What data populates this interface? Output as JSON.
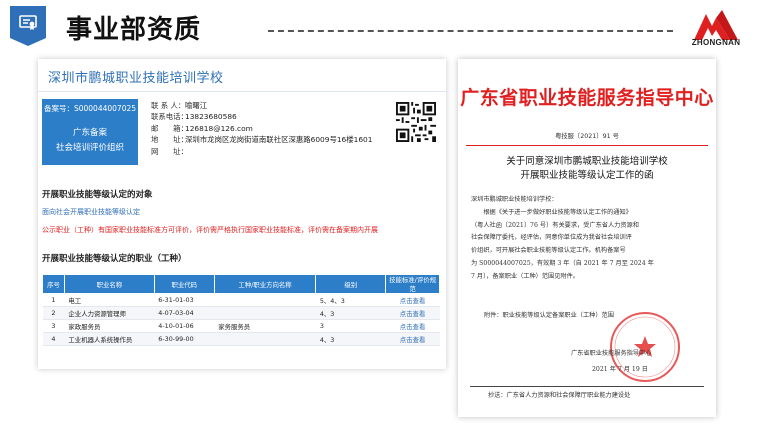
{
  "header": {
    "title": "事业部资质",
    "logo_text": "ZHONGNAN",
    "accent_color": "#2f6fb7"
  },
  "card": {
    "school_name": "深圳市鹏城职业技能培训学校",
    "badge": {
      "record_no": "备案号：S000044007025",
      "line1": "广东备案",
      "line2": "社会培训评价组织"
    },
    "contact": [
      {
        "label": "联 系 人：",
        "value": "喻曙江"
      },
      {
        "label": "联系电话：",
        "value": "13823680586"
      },
      {
        "label": "邮　　箱：",
        "value": "126818@126.com"
      },
      {
        "label": "地　　址：",
        "value": "深圳市龙岗区龙岗街道南联社区深惠路6009号16楼1601"
      },
      {
        "label": "网　　址：",
        "value": ""
      }
    ],
    "section1_title": "开展职业技能等级认定的对象",
    "section1_line1": "面向社会开展职业技能等级认定",
    "section1_line2": "公示职业（工种）有国家职业技能标准方可评价，评价需严格执行国家职业技能标准，评价需在备案期内开展",
    "section2_title": "开展职业技能等级认定的职业（工种）",
    "table": {
      "headers": [
        "序号",
        "职业名称",
        "职业代码",
        "工种/职业方向名称",
        "级别",
        "技能标准/评价规范"
      ],
      "rows": [
        [
          "1",
          "电工",
          "6-31-01-03",
          "",
          "5、4、3",
          "点击查看"
        ],
        [
          "2",
          "企业人力资源管理师",
          "4-07-03-04",
          "",
          "4、3",
          "点击查看"
        ],
        [
          "3",
          "家政服务员",
          "4-10-01-06",
          "家务服务员",
          "3",
          "点击查看"
        ],
        [
          "4",
          "工业机器人系统操作员",
          "6-30-99-00",
          "",
          "4、3",
          "点击查看"
        ]
      ]
    }
  },
  "doc": {
    "heading": "广东省职业技能服务指导中心",
    "number": "粤技服〔2021〕91 号",
    "title1": "关于同意深圳市鹏城职业技能培训学校",
    "title2": "开展职业技能等级认定工作的函",
    "body": [
      "深圳市鹏城职业技能培训学校：",
      "　　根据《关于进一步做好职业技能等级认定工作的通知》",
      "（粤人社函〔2021〕76 号）有关要求，受广东省人力资源和",
      "社会保障厅委托，经评估，同意你单位成为我省社会培训评",
      "价组织，可开展社会职业技能等级认定工作。机构备案号",
      "为 S000044007025，有效期 3 年（自 2021 年 7 月至 2024 年",
      "7 月），备案职业（工种）范围见附件。"
    ],
    "attachment": "附件：职业技能等级认定备案职业（工种）范围",
    "org": "广东省职业技能服务指导中心",
    "date": "2021 年 7 月 19 日",
    "cc": "抄送：广东省人力资源和社会保障厅职业能力建设处",
    "red_color": "#e02020"
  }
}
